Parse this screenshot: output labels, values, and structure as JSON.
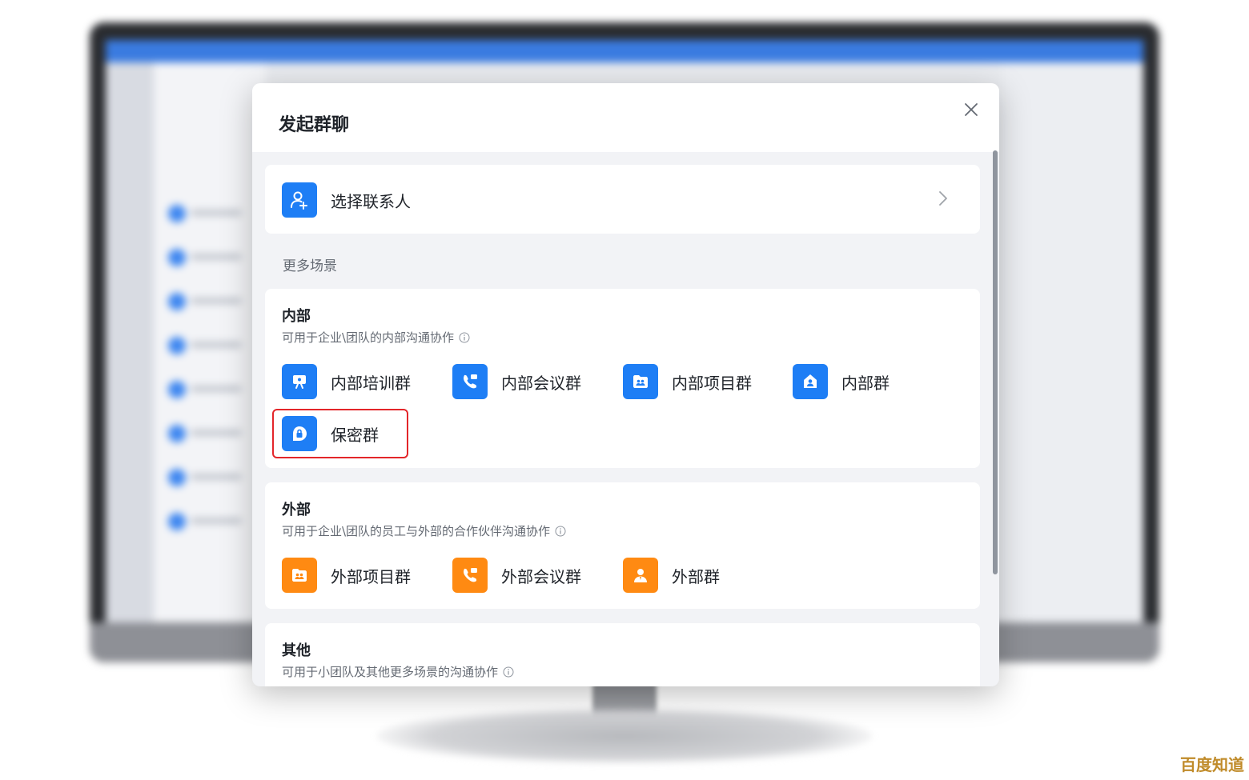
{
  "dialog": {
    "title": "发起群聊"
  },
  "contact": {
    "label": "选择联系人",
    "icon": "add-contact-icon"
  },
  "more_scenes_label": "更多场景",
  "internal": {
    "title": "内部",
    "desc": "可用于企业\\团队的内部沟通协作",
    "options": [
      {
        "label": "内部培训群",
        "icon": "training-icon"
      },
      {
        "label": "内部会议群",
        "icon": "phone-icon"
      },
      {
        "label": "内部项目群",
        "icon": "folder-users-icon"
      },
      {
        "label": "内部群",
        "icon": "building-user-icon"
      },
      {
        "label": "保密群",
        "icon": "lock-icon"
      }
    ]
  },
  "external": {
    "title": "外部",
    "desc": "可用于企业\\团队的员工与外部的合作伙伴沟通协作",
    "options": [
      {
        "label": "外部项目群",
        "icon": "folder-users-icon"
      },
      {
        "label": "外部会议群",
        "icon": "phone-icon"
      },
      {
        "label": "外部群",
        "icon": "user-tie-icon"
      }
    ]
  },
  "other": {
    "title": "其他",
    "desc": "可用于小团队及其他更多场景的沟通协作"
  },
  "colors": {
    "internal_accent": "#1e7ef5",
    "external_accent": "#ff8a12",
    "highlight": "#e3262a"
  },
  "watermark": "百度知道"
}
